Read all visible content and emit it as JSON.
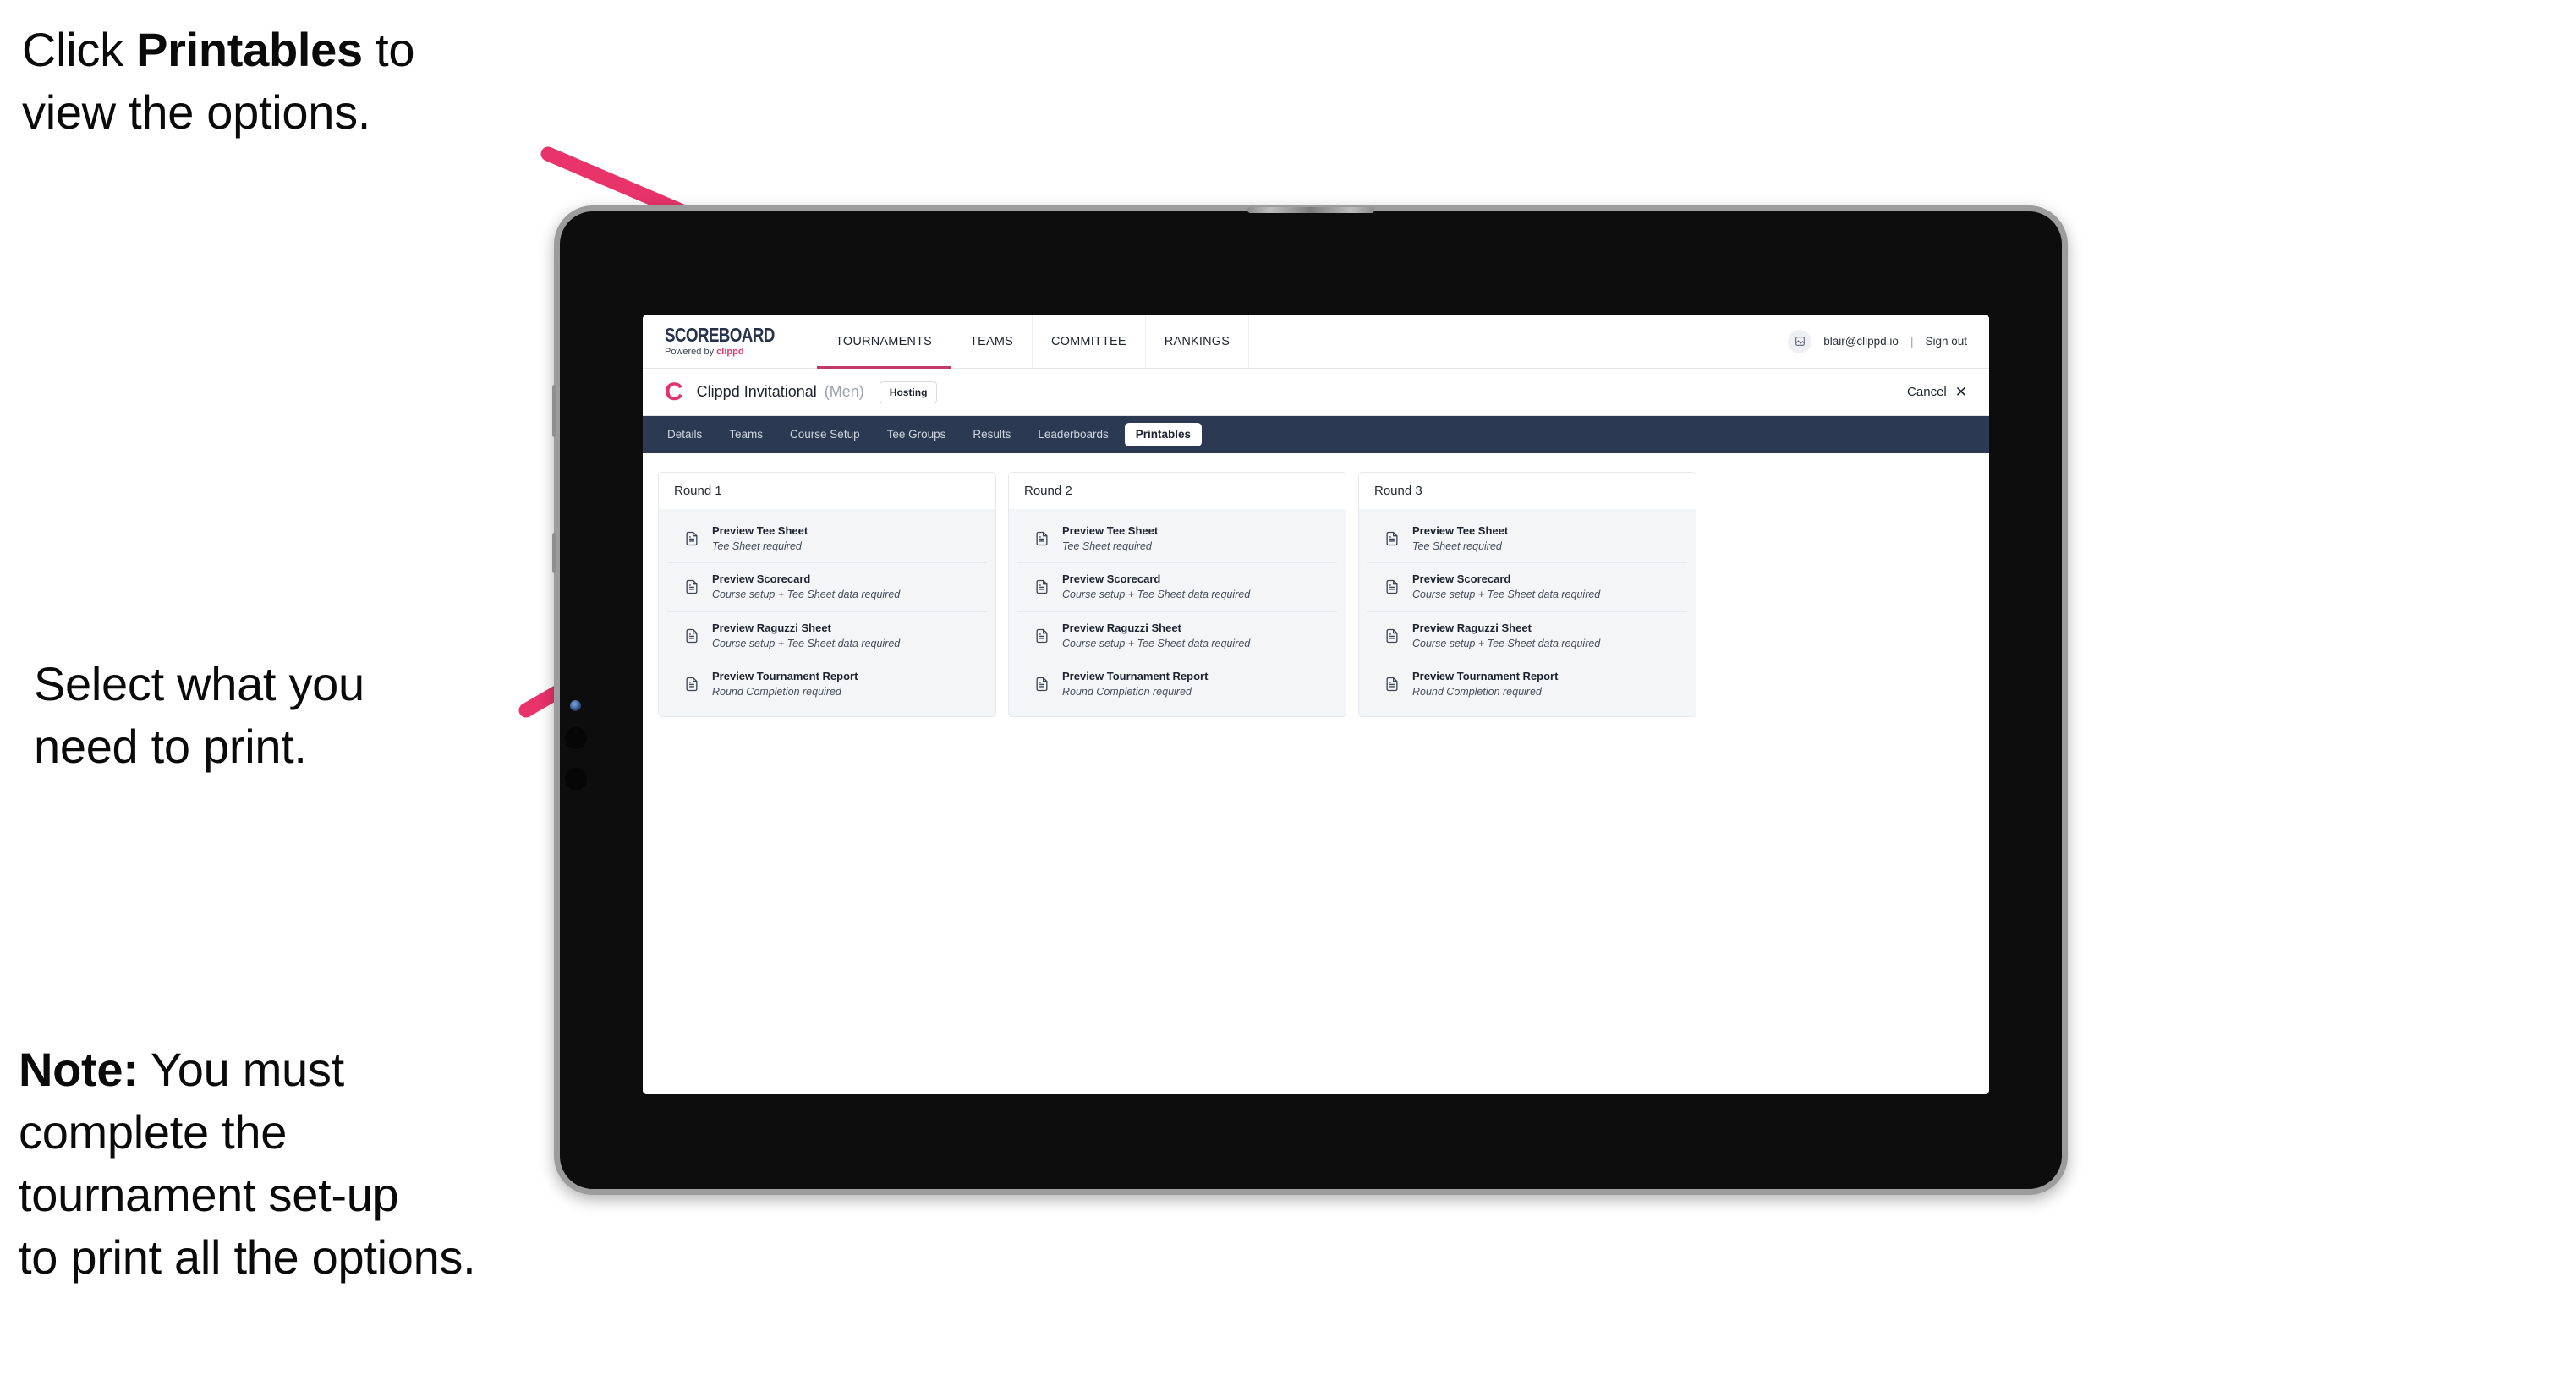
{
  "annotations": {
    "click_printables": "Click Printables to\nview the options.",
    "click_printables_bold": "Printables",
    "click_printables_pre": "Click ",
    "click_printables_post": " to\nview the options.",
    "select_print": "Select what you\n need to print.",
    "note_bold": "Note:",
    "note_rest": " You must\ncomplete the\ntournament set-up\nto print all the options."
  },
  "colors": {
    "arrow": "#e8336b",
    "accent_pink": "#e0336b",
    "tabbar_navy": "#2b3a52",
    "nav_underline": "#c2386a",
    "card_grey": "#f4f5f7"
  },
  "app": {
    "brand": {
      "title": "SCOREBOARD",
      "powered_prefix": "Powered by ",
      "powered_brand": "clippd"
    },
    "nav_tabs": [
      {
        "label": "TOURNAMENTS",
        "active": true
      },
      {
        "label": "TEAMS",
        "active": false
      },
      {
        "label": "COMMITTEE",
        "active": false
      },
      {
        "label": "RANKINGS",
        "active": false
      }
    ],
    "user": {
      "avatar_icon": "user-avatar-icon",
      "email": "blair@clippd.io",
      "separator": "|",
      "sign_out": "Sign out"
    },
    "title_row": {
      "logo_mark": "C",
      "tournament_name": "Clippd Invitational",
      "gender": "(Men)",
      "hosting_badge": "Hosting",
      "cancel_label": "Cancel",
      "cancel_icon": "close-icon"
    },
    "section_tabs": [
      {
        "label": "Details",
        "active": false
      },
      {
        "label": "Teams",
        "active": false
      },
      {
        "label": "Course Setup",
        "active": false
      },
      {
        "label": "Tee Groups",
        "active": false
      },
      {
        "label": "Results",
        "active": false
      },
      {
        "label": "Leaderboards",
        "active": false
      },
      {
        "label": "Printables",
        "active": true
      }
    ],
    "rounds": [
      {
        "title": "Round 1",
        "items": [
          {
            "title": "Preview Tee Sheet",
            "sub": "Tee Sheet required"
          },
          {
            "title": "Preview Scorecard",
            "sub": "Course setup + Tee Sheet data required"
          },
          {
            "title": "Preview Raguzzi Sheet",
            "sub": "Course setup + Tee Sheet data required"
          },
          {
            "title": "Preview Tournament Report",
            "sub": "Round Completion required"
          }
        ]
      },
      {
        "title": "Round 2",
        "items": [
          {
            "title": "Preview Tee Sheet",
            "sub": "Tee Sheet required"
          },
          {
            "title": "Preview Scorecard",
            "sub": "Course setup + Tee Sheet data required"
          },
          {
            "title": "Preview Raguzzi Sheet",
            "sub": "Course setup + Tee Sheet data required"
          },
          {
            "title": "Preview Tournament Report",
            "sub": "Round Completion required"
          }
        ]
      },
      {
        "title": "Round 3",
        "items": [
          {
            "title": "Preview Tee Sheet",
            "sub": "Tee Sheet required"
          },
          {
            "title": "Preview Scorecard",
            "sub": "Course setup + Tee Sheet data required"
          },
          {
            "title": "Preview Raguzzi Sheet",
            "sub": "Course setup + Tee Sheet data required"
          },
          {
            "title": "Preview Tournament Report",
            "sub": "Round Completion required"
          }
        ]
      }
    ]
  }
}
